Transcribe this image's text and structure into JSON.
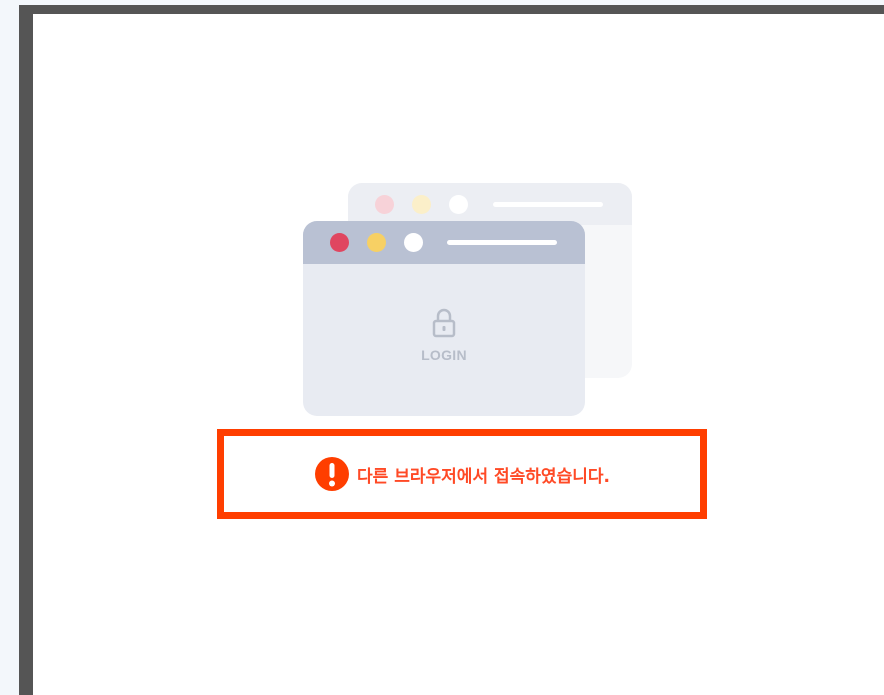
{
  "illustration": {
    "login_label": "LOGIN",
    "lock_icon": "lock-icon",
    "colors": {
      "front_titlebar": "#b9c1d3",
      "front_body": "#e8ebf2",
      "back_titlebar": "#eceef3",
      "back_body": "#f6f7f9",
      "dot_red": "#e04660",
      "dot_yellow": "#f7d064",
      "dot_white": "#ffffff"
    }
  },
  "message": {
    "text": "다른 브라우저에서 접속하였습니다.",
    "icon": "alert-icon",
    "color": "#ff4a26",
    "highlight_border": "#ff3e00"
  }
}
